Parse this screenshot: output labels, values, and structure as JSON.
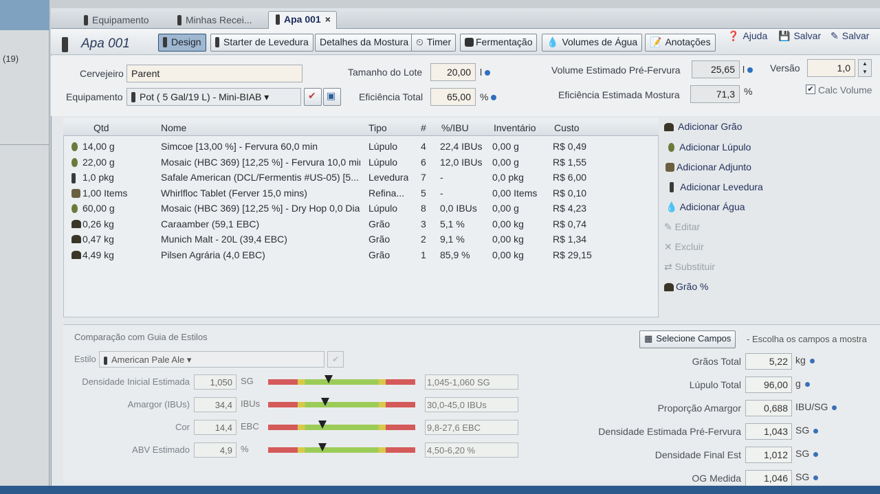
{
  "left_panel": {
    "count": "(19)"
  },
  "tabs": [
    {
      "label": "Equipamento"
    },
    {
      "label": "Minhas Recei..."
    },
    {
      "label": "Apa 001"
    }
  ],
  "tab_close": "×",
  "recipe_title": "Apa 001",
  "toolbar": {
    "design": "Design",
    "starter": "Starter de Levedura",
    "mostura": "Detalhes da Mostura",
    "timer": "Timer",
    "fermentacao": "Fermentação",
    "volumes": "Volumes de Água",
    "anotacoes": "Anotações",
    "ajuda": "Ajuda",
    "salvar": "Salvar",
    "salvar2": "Salvar"
  },
  "form": {
    "cervejeiro_label": "Cervejeiro",
    "cervejeiro_value": "Parent",
    "equipamento_label": "Equipamento",
    "equipamento_value": "Pot ( 5 Gal/19 L) - Mini-BIAB",
    "lote_label": "Tamanho do Lote",
    "lote_value": "20,00",
    "lote_unit": "l",
    "eficiencia_label": "Eficiência Total",
    "eficiencia_value": "65,00",
    "eficiencia_unit": "%",
    "volume_label": "Volume Estimado Pré-Fervura",
    "volume_value": "25,65",
    "volume_unit": "l",
    "versao_label": "Versão",
    "versao_value": "1,0",
    "mostura_label": "Eficiência Estimada Mostura",
    "mostura_value": "71,3",
    "mostura_unit": "%",
    "calc_volume_label": "Calc Volume"
  },
  "table": {
    "headers": {
      "qtd": "Qtd",
      "nome": "Nome",
      "tipo": "Tipo",
      "num": "#",
      "ibu": "%/IBU",
      "inventario": "Inventário",
      "custo": "Custo"
    },
    "rows": [
      {
        "icon": "hop-icon",
        "qtd": "14,00 g",
        "nome": "Simcoe [13,00 %] - Fervura 60,0 min",
        "tipo": "Lúpulo",
        "num": "4",
        "ibu": "22,4 IBUs",
        "inventario": "0,00 g",
        "custo": "R$ 0,49"
      },
      {
        "icon": "hop-icon",
        "qtd": "22,00 g",
        "nome": "Mosaic (HBC 369) [12,25 %] - Fervura 10,0 min",
        "tipo": "Lúpulo",
        "num": "6",
        "ibu": "12,0 IBUs",
        "inventario": "0,00 g",
        "custo": "R$ 1,55"
      },
      {
        "icon": "yeast-icon",
        "qtd": "1,0 pkg",
        "nome": "Safale American  (DCL/Fermentis #US-05) [5...",
        "tipo": "Levedura",
        "num": "7",
        "ibu": "-",
        "inventario": "0,0 pkg",
        "custo": "R$ 6,00"
      },
      {
        "icon": "misc-icon",
        "qtd": "1,00 Items",
        "nome": "Whirlfloc Tablet (Ferver 15,0 mins)",
        "tipo": "Refina...",
        "num": "5",
        "ibu": "-",
        "inventario": "0,00 Items",
        "custo": "R$ 0,10"
      },
      {
        "icon": "hop-icon",
        "qtd": "60,00 g",
        "nome": "Mosaic (HBC 369) [12,25 %] - Dry Hop 0,0 Dias",
        "tipo": "Lúpulo",
        "num": "8",
        "ibu": "0,0 IBUs",
        "inventario": "0,00 g",
        "custo": "R$ 4,23"
      },
      {
        "icon": "grain-icon",
        "qtd": "0,26 kg",
        "nome": "Caraamber (59,1 EBC)",
        "tipo": "Grão",
        "num": "3",
        "ibu": "5,1 %",
        "inventario": "0,00 kg",
        "custo": "R$ 0,74"
      },
      {
        "icon": "grain-icon",
        "qtd": "0,47 kg",
        "nome": "Munich Malt - 20L (39,4 EBC)",
        "tipo": "Grão",
        "num": "2",
        "ibu": "9,1 %",
        "inventario": "0,00 kg",
        "custo": "R$ 1,34"
      },
      {
        "icon": "grain-icon",
        "qtd": "4,49 kg",
        "nome": "Pilsen Agrária (4,0 EBC)",
        "tipo": "Grão",
        "num": "1",
        "ibu": "85,9 %",
        "inventario": "0,00 kg",
        "custo": "R$ 29,15"
      }
    ]
  },
  "side_actions": {
    "add_grao": "Adicionar Grão",
    "add_lupulo": "Adicionar Lúpulo",
    "add_adjunto": "Adicionar Adjunto",
    "add_levedura": "Adicionar Levedura",
    "add_agua": "Adicionar Água",
    "editar": "Editar",
    "excluir": "Excluir",
    "substituir": "Substituir",
    "grao_pct": "Grão %"
  },
  "style_guide": {
    "title": "Comparação com Guia de Estilos",
    "estilo_label": "Estilo",
    "estilo_value": "American Pale Ale",
    "metrics": [
      {
        "label": "Densidade Inicial Estimada",
        "value": "1,050",
        "unit": "SG",
        "range": "1,045-1,060 SG",
        "level": 0.41
      },
      {
        "label": "Amargor (IBUs)",
        "value": "34,4",
        "unit": "IBUs",
        "range": "30,0-45,0 IBUs",
        "level": 0.39
      },
      {
        "label": "Cor",
        "value": "14,4",
        "unit": "EBC",
        "range": "9,8-27,6 EBC",
        "level": 0.37
      },
      {
        "label": "ABV Estimado",
        "value": "4,9",
        "unit": "%",
        "range": "4,50-6,20 %",
        "level": 0.37
      }
    ]
  },
  "stats": {
    "select_button": "Selecione Campos",
    "select_hint": "- Escolha os campos a mostra",
    "items": [
      {
        "label": "Grãos Total",
        "value": "5,22",
        "unit": "kg"
      },
      {
        "label": "Lúpulo Total",
        "value": "96,00",
        "unit": "g"
      },
      {
        "label": "Proporção Amargor",
        "value": "0,688",
        "unit": "IBU/SG"
      },
      {
        "label": "Densidade Estimada Pré-Fervura",
        "value": "1,043",
        "unit": "SG"
      },
      {
        "label": "Densidade Final Est",
        "value": "1,012",
        "unit": "SG"
      },
      {
        "label": "OG Medida",
        "value": "1,046",
        "unit": "SG"
      }
    ]
  },
  "colors": {
    "accent": "#2f6fc0",
    "active_tab_text": "#1a2a5a"
  }
}
